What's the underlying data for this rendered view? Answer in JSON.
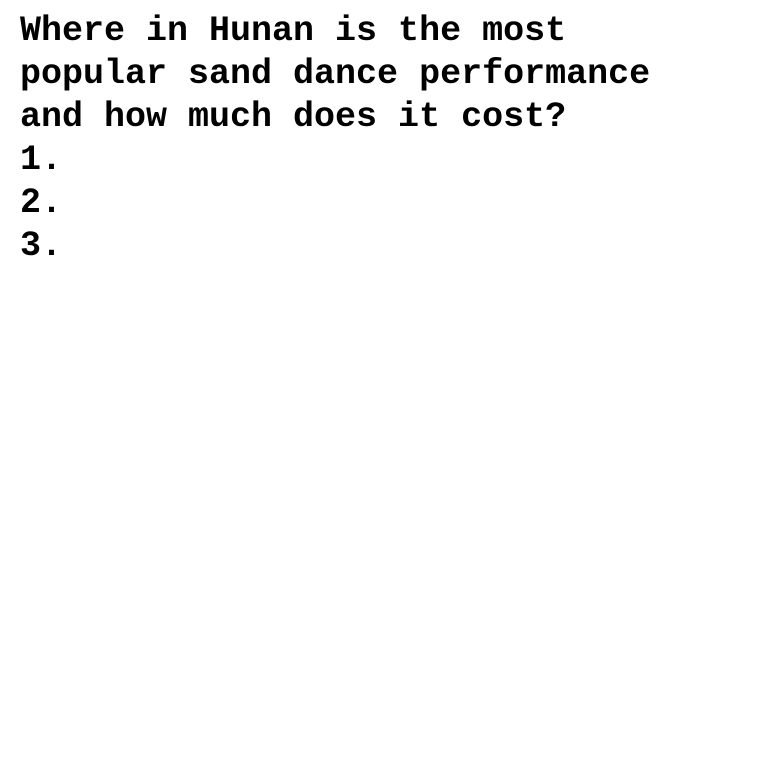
{
  "question": "Where in Hunan is the most\npopular sand dance performance\nand how much does it cost?",
  "list": {
    "items": [
      {
        "marker": "1.",
        "text": ""
      },
      {
        "marker": "2.",
        "text": ""
      },
      {
        "marker": "3.",
        "text": ""
      }
    ]
  }
}
